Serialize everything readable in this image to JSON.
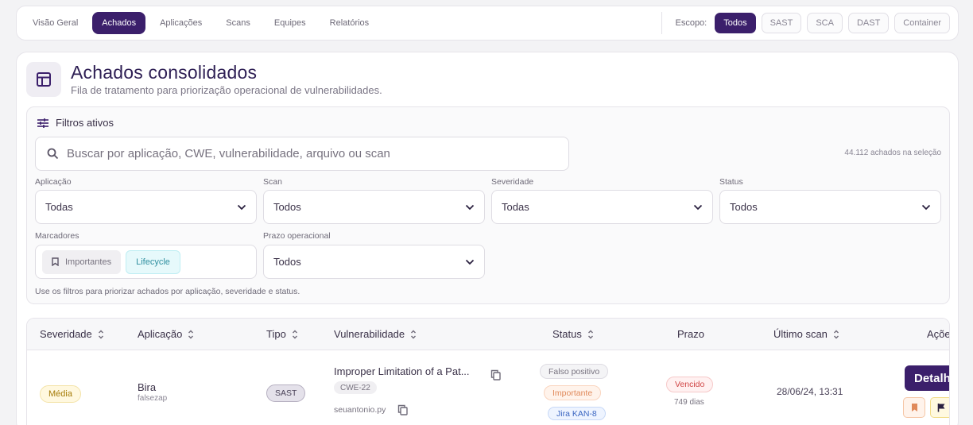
{
  "nav": {
    "tabs": [
      "Visão Geral",
      "Achados",
      "Aplicações",
      "Scans",
      "Equipes",
      "Relatórios"
    ],
    "active_tab": "Achados",
    "scope_label": "Escopo:",
    "scopes": [
      "Todos",
      "SAST",
      "SCA",
      "DAST",
      "Container"
    ]
  },
  "header": {
    "title": "Achados consolidados",
    "subtitle": "Fila de tratamento para priorização operacional de vulnerabilidades.",
    "icon": "table-icon"
  },
  "filters": {
    "title": "Filtros ativos",
    "search_placeholder": "Buscar por aplicação, CWE, vulnerabilidade, arquivo ou scan",
    "search_value": "",
    "count_text": "44.112 achados na seleção",
    "aplicacao": {
      "label": "Aplicação",
      "value": "Todas"
    },
    "scan": {
      "label": "Scan",
      "value": "Todos"
    },
    "severidade": {
      "label": "Severidade",
      "value": "Todas"
    },
    "status": {
      "label": "Status",
      "value": "Todos"
    },
    "marcadores": {
      "label": "Marcadores",
      "chips": [
        "Importantes",
        "Lifecycle"
      ]
    },
    "prazo": {
      "label": "Prazo operacional",
      "value": "Todos"
    },
    "hint": "Use os filtros para priorizar achados por aplicação, severidade e status."
  },
  "table": {
    "columns": [
      "Severidade",
      "Aplicação",
      "Tipo",
      "Vulnerabilidade",
      "Status",
      "Prazo",
      "Último scan",
      "Açõe"
    ],
    "rows": [
      {
        "severidade": "Média",
        "aplicacao": "Bira",
        "aplicacao_sub": "falsezap",
        "tipo": "SAST",
        "vulnerabilidade": "Improper Limitation of a Pat...",
        "cwe": "CWE-22",
        "arquivo": "seuantonio.py",
        "status": [
          "Falso positivo",
          "Importante",
          "Jira KAN-8"
        ],
        "prazo": "Vencido",
        "prazo_dias": "749 dias",
        "ultimo_scan": "28/06/24, 13:31",
        "acao": "Detalh"
      }
    ]
  },
  "colors": {
    "primary": "#3b1f6b",
    "media": "#a57b08",
    "vencido": "#d04646",
    "importante": "#e0895a",
    "jira": "#3b66c1",
    "lifecycle": "#2f8fa0"
  }
}
